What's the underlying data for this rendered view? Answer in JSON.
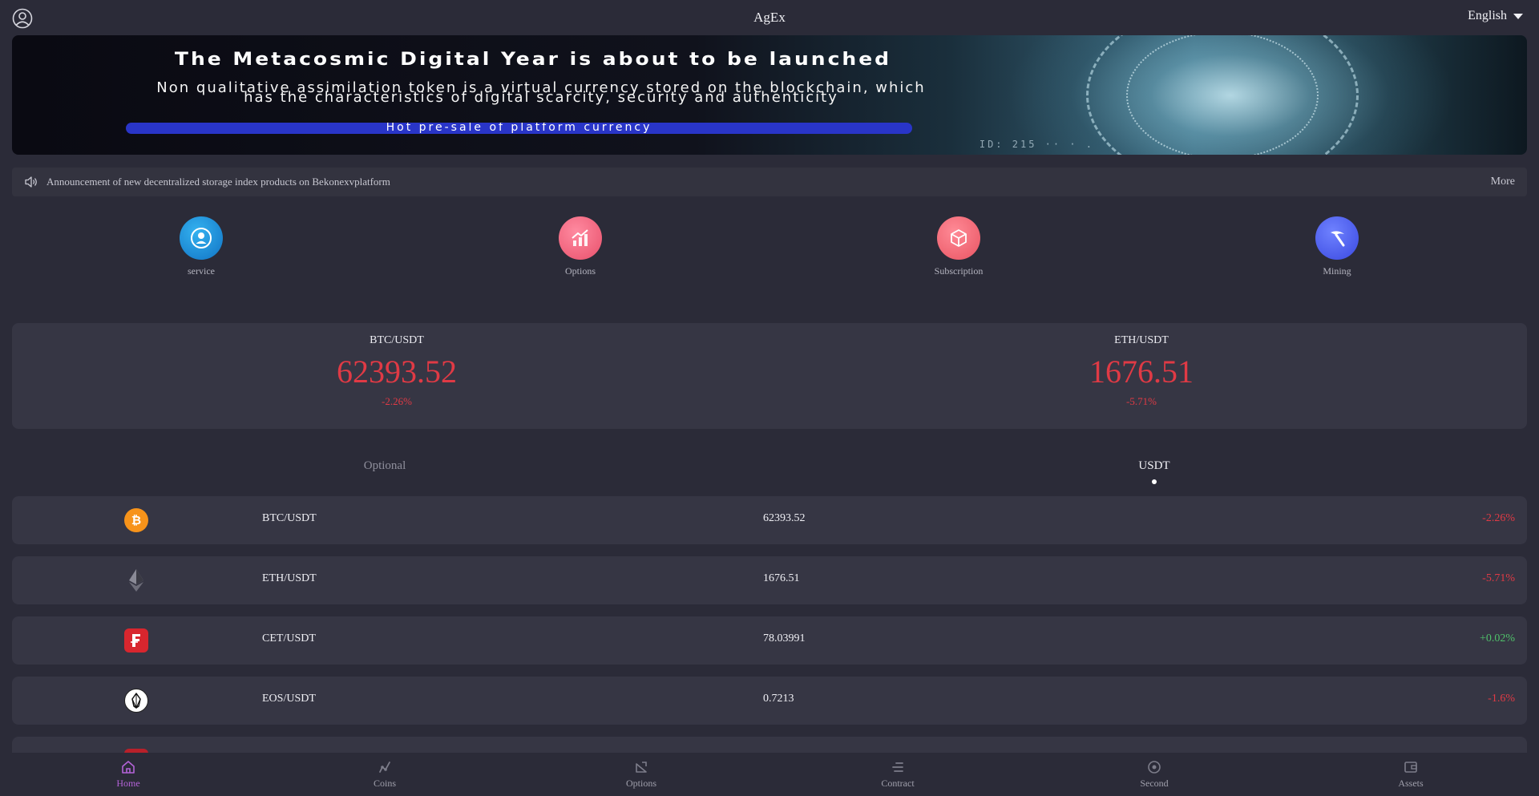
{
  "header": {
    "title": "AgEx",
    "language": "English",
    "user_icon": "user-circle-icon",
    "caret_icon": "caret-down-icon"
  },
  "banner": {
    "headline": "The Metacosmic Digital Year is about to be launched",
    "subtext": "Non qualitative assimilation token is a virtual currency stored on the blockchain, which has the characteristics of digital scarcity, security and authenticity",
    "presale": "Hot pre-sale of platform currency",
    "corner_text": "ID: 215 ·· · ."
  },
  "notice": {
    "icon": "speaker-icon",
    "text": "Announcement of new decentralized storage index products on Bekonexvplatform",
    "more": "More"
  },
  "quick_links": [
    {
      "label": "service",
      "icon": "service-icon",
      "color": "#1a8fd6"
    },
    {
      "label": "Options",
      "icon": "chart-up-icon",
      "color": "#f0607a"
    },
    {
      "label": "Subscription",
      "icon": "box-icon",
      "color": "#f06070"
    },
    {
      "label": "Mining",
      "icon": "pickaxe-icon",
      "color": "#4a5cf0"
    }
  ],
  "tickers": [
    {
      "pair": "BTC/USDT",
      "price": "62393.52",
      "change": "-2.26%"
    },
    {
      "pair": "ETH/USDT",
      "price": "1676.51",
      "change": "-5.71%"
    }
  ],
  "tabs": {
    "optional": "Optional",
    "usdt": "USDT"
  },
  "market": [
    {
      "pair": "BTC/USDT",
      "price": "62393.52",
      "change": "-2.26%",
      "icon": "bitcoin-icon"
    },
    {
      "pair": "ETH/USDT",
      "price": "1676.51",
      "change": "-5.71%",
      "icon": "ethereum-icon"
    },
    {
      "pair": "CET/USDT",
      "price": "78.03991",
      "change": "+0.02%",
      "icon": "cet-icon"
    },
    {
      "pair": "EOS/USDT",
      "price": "0.7213",
      "change": "-1.6%",
      "icon": "eos-icon"
    }
  ],
  "nav": [
    {
      "label": "Home",
      "icon": "home-icon",
      "active": true
    },
    {
      "label": "Coins",
      "icon": "coins-icon"
    },
    {
      "label": "Options",
      "icon": "options-icon"
    },
    {
      "label": "Contract",
      "icon": "contract-icon"
    },
    {
      "label": "Second",
      "icon": "second-icon"
    },
    {
      "label": "Assets",
      "icon": "wallet-icon"
    }
  ]
}
